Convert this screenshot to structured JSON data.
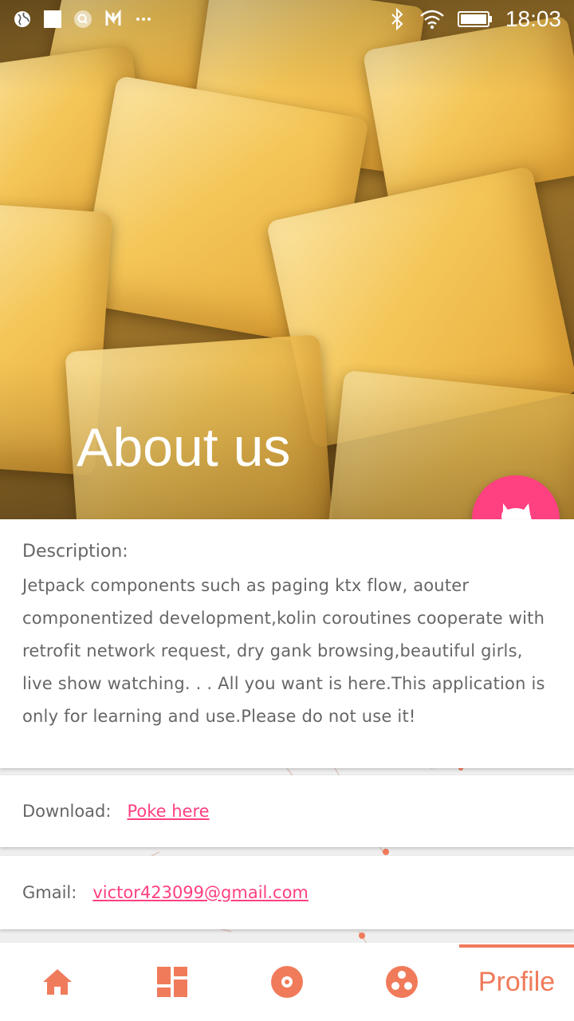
{
  "status_bar": {
    "time": "18:03",
    "left_icons": [
      "globe-icon",
      "square-icon",
      "search-circle-icon",
      "n-icon",
      "more-icon"
    ],
    "right_icons": [
      "bluetooth-icon",
      "wifi-icon",
      "battery-icon"
    ]
  },
  "hero": {
    "title": "About us"
  },
  "fab": {
    "icon": "github-icon",
    "color": "#ff4081"
  },
  "description": {
    "label": "Description:",
    "text": "Jetpack components such as paging ktx flow, aouter componentized development,kolin coroutines cooperate with retrofit network request, dry gank browsing,beautiful girls, live show watching. . . All you want is here.This application is only for learning and use.Please do not use it!"
  },
  "download": {
    "label": "Download:",
    "link_text": "Poke here"
  },
  "gmail": {
    "label": "Gmail:",
    "link_text": "victor423099@gmail.com"
  },
  "bottom_nav": {
    "items": [
      {
        "icon": "home-icon"
      },
      {
        "icon": "dashboard-icon"
      },
      {
        "icon": "disc-icon"
      },
      {
        "icon": "dots-circle-icon"
      },
      {
        "label": "Profile",
        "active": true
      }
    ],
    "accent": "#f07b5a"
  }
}
